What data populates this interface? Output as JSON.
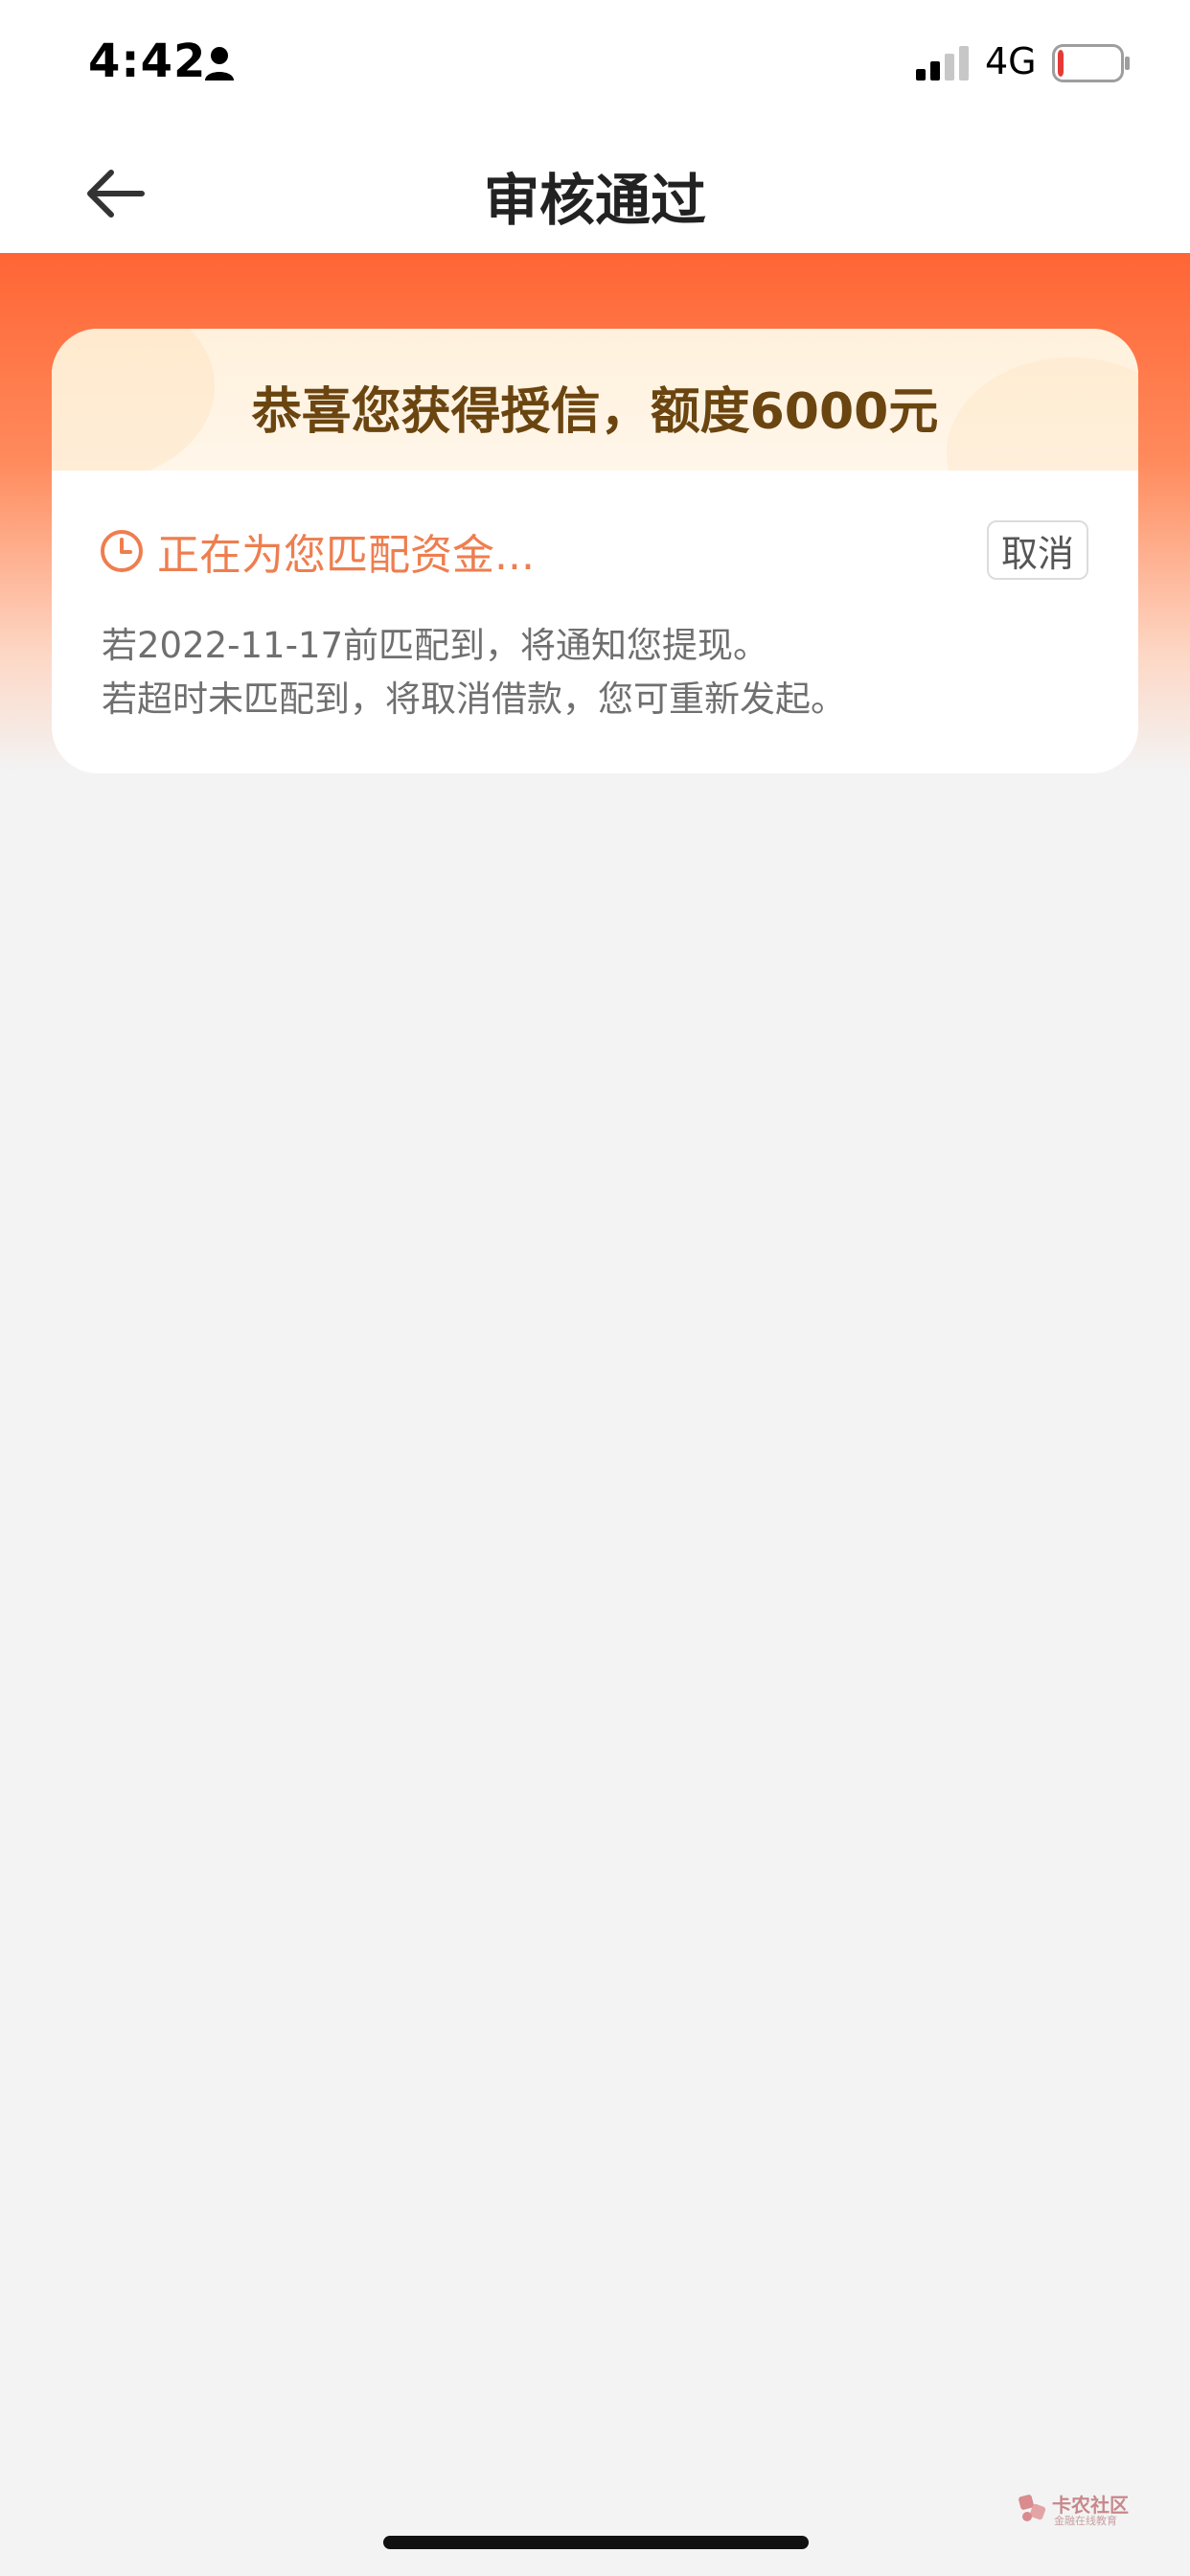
{
  "status_bar": {
    "time": "4:42",
    "network": "4G",
    "icons": [
      "person-icon",
      "signal-icon",
      "battery-icon"
    ],
    "battery_level": 0.1
  },
  "nav": {
    "title": "审核通过",
    "back_icon": "arrow-left-icon"
  },
  "card": {
    "credit_text": "恭喜您获得授信，额度6000元",
    "matching_text": "正在为您匹配资金...",
    "matching_icon": "clock-icon",
    "cancel_label": "取消",
    "notice_line_1": "若2022-11-17前匹配到，将通知您提现。",
    "notice_line_2": "若超时未匹配到，将取消借款，您可重新发起。"
  },
  "watermark": {
    "title": "卡农社区",
    "subtitle": "金融在线教育"
  },
  "colors": {
    "accent": "#ff6535",
    "matching_text": "#ee7e4f",
    "credit_text": "#6b4510",
    "battery_low": "#e53935",
    "background": "#f3f3f3"
  }
}
